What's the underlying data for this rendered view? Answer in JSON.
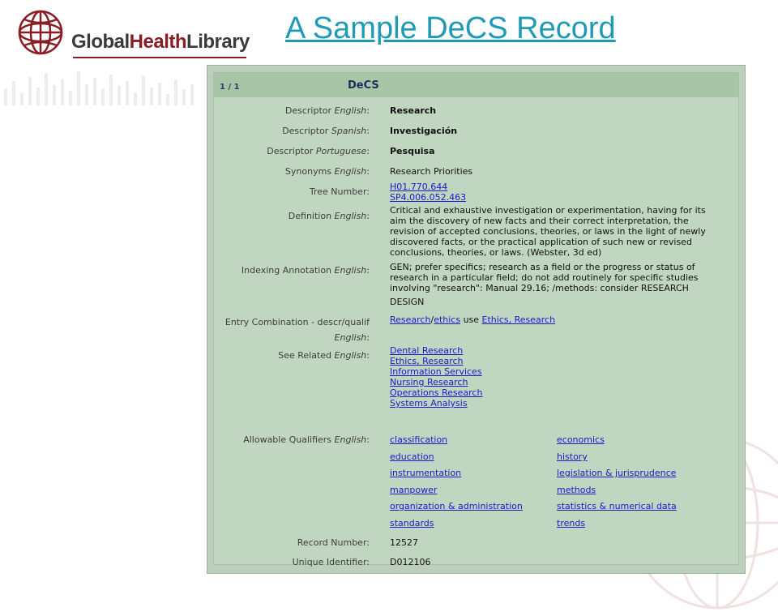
{
  "logo": {
    "text_main": "Global",
    "text_accent": "Health",
    "text_end": "Library"
  },
  "slide_title": "A Sample DeCS Record",
  "record": {
    "counter": "1 / 1",
    "title": "DeCS",
    "fields": {
      "descriptor_english": {
        "label": "Descriptor",
        "lang": "English",
        "value": "Research"
      },
      "descriptor_spanish": {
        "label": "Descriptor",
        "lang": "Spanish",
        "value": "Investigación"
      },
      "descriptor_portuguese": {
        "label": "Descriptor",
        "lang": "Portuguese",
        "value": "Pesquisa"
      },
      "synonyms_english": {
        "label": "Synonyms",
        "lang": "English",
        "value": "Research Priorities"
      },
      "tree_number": {
        "label": "Tree Number",
        "values": [
          "H01.770.644",
          "SP4.006.052.463"
        ]
      },
      "definition_english": {
        "label": "Definition",
        "lang": "English",
        "lines": [
          "Critical and exhaustive investigation or experimentation, having for its",
          "aim the discovery of new facts and their correct interpretation, the",
          "revision of accepted conclusions, theories, or laws in the light of newly",
          "discovered facts, or the practical application of such new or revised",
          "conclusions, theories, or laws. (Webster, 3d ed)"
        ]
      },
      "indexing_annotation_english": {
        "label": "Indexing Annotation",
        "lang": "English",
        "lines": [
          "GEN; prefer specifics; research as a field or the progress or status of",
          "research in a particular field; do not add routinely for specific studies",
          "involving \"research\": Manual 29.16; /methods: consider RESEARCH",
          "DESIGN"
        ]
      },
      "entry_combination": {
        "label": "Entry Combination - descr/qualif",
        "lang": "English",
        "descr": "Research",
        "slash": "/",
        "qualif": "ethics",
        "use": " use ",
        "target": "Ethics, Research"
      },
      "see_related_english": {
        "label": "See Related",
        "lang": "English",
        "values": [
          "Dental Research",
          "Ethics, Research",
          "Information Services",
          "Nursing Research",
          "Operations Research",
          "Systems Analysis"
        ]
      },
      "allowable_qualifiers_english": {
        "label": "Allowable Qualifiers",
        "lang": "English",
        "left": [
          "classification",
          "education",
          "instrumentation",
          "manpower",
          "organization & administration",
          "standards"
        ],
        "right": [
          "economics",
          "history",
          "legislation & jurisprudence",
          "methods",
          "statistics & numerical data",
          "trends"
        ]
      },
      "record_number": {
        "label": "Record Number",
        "value": "12527"
      },
      "unique_identifier": {
        "label": "Unique Identifier",
        "value": "D012106"
      }
    }
  },
  "colors": {
    "title": "#1f9bb5",
    "panel": "#c0d6c0",
    "header": "#a8c5a8",
    "link": "#1a1acc",
    "logo_accent": "#8a1c24"
  }
}
